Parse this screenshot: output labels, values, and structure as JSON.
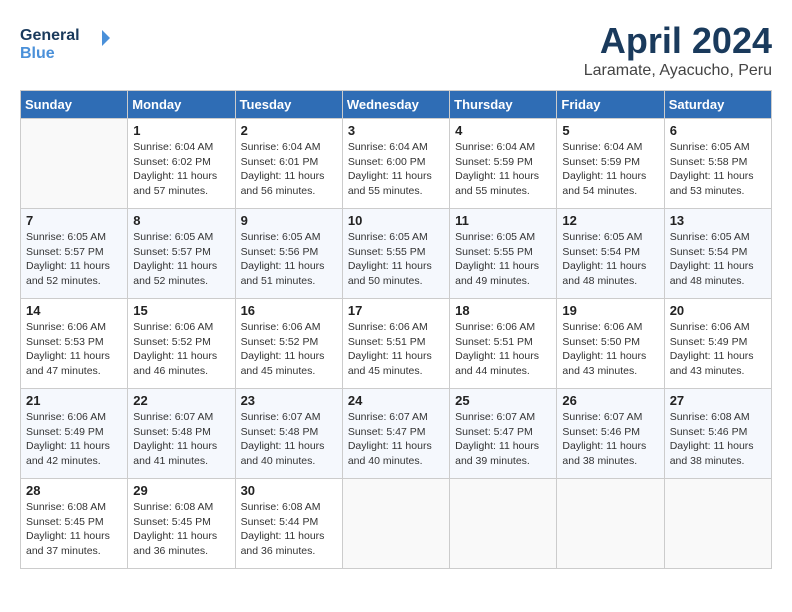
{
  "header": {
    "logo_line1": "General",
    "logo_line2": "Blue",
    "month_title": "April 2024",
    "subtitle": "Laramate, Ayacucho, Peru"
  },
  "weekdays": [
    "Sunday",
    "Monday",
    "Tuesday",
    "Wednesday",
    "Thursday",
    "Friday",
    "Saturday"
  ],
  "weeks": [
    [
      {
        "num": "",
        "info": ""
      },
      {
        "num": "1",
        "info": "Sunrise: 6:04 AM\nSunset: 6:02 PM\nDaylight: 11 hours\nand 57 minutes."
      },
      {
        "num": "2",
        "info": "Sunrise: 6:04 AM\nSunset: 6:01 PM\nDaylight: 11 hours\nand 56 minutes."
      },
      {
        "num": "3",
        "info": "Sunrise: 6:04 AM\nSunset: 6:00 PM\nDaylight: 11 hours\nand 55 minutes."
      },
      {
        "num": "4",
        "info": "Sunrise: 6:04 AM\nSunset: 5:59 PM\nDaylight: 11 hours\nand 55 minutes."
      },
      {
        "num": "5",
        "info": "Sunrise: 6:04 AM\nSunset: 5:59 PM\nDaylight: 11 hours\nand 54 minutes."
      },
      {
        "num": "6",
        "info": "Sunrise: 6:05 AM\nSunset: 5:58 PM\nDaylight: 11 hours\nand 53 minutes."
      }
    ],
    [
      {
        "num": "7",
        "info": "Sunrise: 6:05 AM\nSunset: 5:57 PM\nDaylight: 11 hours\nand 52 minutes."
      },
      {
        "num": "8",
        "info": "Sunrise: 6:05 AM\nSunset: 5:57 PM\nDaylight: 11 hours\nand 52 minutes."
      },
      {
        "num": "9",
        "info": "Sunrise: 6:05 AM\nSunset: 5:56 PM\nDaylight: 11 hours\nand 51 minutes."
      },
      {
        "num": "10",
        "info": "Sunrise: 6:05 AM\nSunset: 5:55 PM\nDaylight: 11 hours\nand 50 minutes."
      },
      {
        "num": "11",
        "info": "Sunrise: 6:05 AM\nSunset: 5:55 PM\nDaylight: 11 hours\nand 49 minutes."
      },
      {
        "num": "12",
        "info": "Sunrise: 6:05 AM\nSunset: 5:54 PM\nDaylight: 11 hours\nand 48 minutes."
      },
      {
        "num": "13",
        "info": "Sunrise: 6:05 AM\nSunset: 5:54 PM\nDaylight: 11 hours\nand 48 minutes."
      }
    ],
    [
      {
        "num": "14",
        "info": "Sunrise: 6:06 AM\nSunset: 5:53 PM\nDaylight: 11 hours\nand 47 minutes."
      },
      {
        "num": "15",
        "info": "Sunrise: 6:06 AM\nSunset: 5:52 PM\nDaylight: 11 hours\nand 46 minutes."
      },
      {
        "num": "16",
        "info": "Sunrise: 6:06 AM\nSunset: 5:52 PM\nDaylight: 11 hours\nand 45 minutes."
      },
      {
        "num": "17",
        "info": "Sunrise: 6:06 AM\nSunset: 5:51 PM\nDaylight: 11 hours\nand 45 minutes."
      },
      {
        "num": "18",
        "info": "Sunrise: 6:06 AM\nSunset: 5:51 PM\nDaylight: 11 hours\nand 44 minutes."
      },
      {
        "num": "19",
        "info": "Sunrise: 6:06 AM\nSunset: 5:50 PM\nDaylight: 11 hours\nand 43 minutes."
      },
      {
        "num": "20",
        "info": "Sunrise: 6:06 AM\nSunset: 5:49 PM\nDaylight: 11 hours\nand 43 minutes."
      }
    ],
    [
      {
        "num": "21",
        "info": "Sunrise: 6:06 AM\nSunset: 5:49 PM\nDaylight: 11 hours\nand 42 minutes."
      },
      {
        "num": "22",
        "info": "Sunrise: 6:07 AM\nSunset: 5:48 PM\nDaylight: 11 hours\nand 41 minutes."
      },
      {
        "num": "23",
        "info": "Sunrise: 6:07 AM\nSunset: 5:48 PM\nDaylight: 11 hours\nand 40 minutes."
      },
      {
        "num": "24",
        "info": "Sunrise: 6:07 AM\nSunset: 5:47 PM\nDaylight: 11 hours\nand 40 minutes."
      },
      {
        "num": "25",
        "info": "Sunrise: 6:07 AM\nSunset: 5:47 PM\nDaylight: 11 hours\nand 39 minutes."
      },
      {
        "num": "26",
        "info": "Sunrise: 6:07 AM\nSunset: 5:46 PM\nDaylight: 11 hours\nand 38 minutes."
      },
      {
        "num": "27",
        "info": "Sunrise: 6:08 AM\nSunset: 5:46 PM\nDaylight: 11 hours\nand 38 minutes."
      }
    ],
    [
      {
        "num": "28",
        "info": "Sunrise: 6:08 AM\nSunset: 5:45 PM\nDaylight: 11 hours\nand 37 minutes."
      },
      {
        "num": "29",
        "info": "Sunrise: 6:08 AM\nSunset: 5:45 PM\nDaylight: 11 hours\nand 36 minutes."
      },
      {
        "num": "30",
        "info": "Sunrise: 6:08 AM\nSunset: 5:44 PM\nDaylight: 11 hours\nand 36 minutes."
      },
      {
        "num": "",
        "info": ""
      },
      {
        "num": "",
        "info": ""
      },
      {
        "num": "",
        "info": ""
      },
      {
        "num": "",
        "info": ""
      }
    ]
  ]
}
